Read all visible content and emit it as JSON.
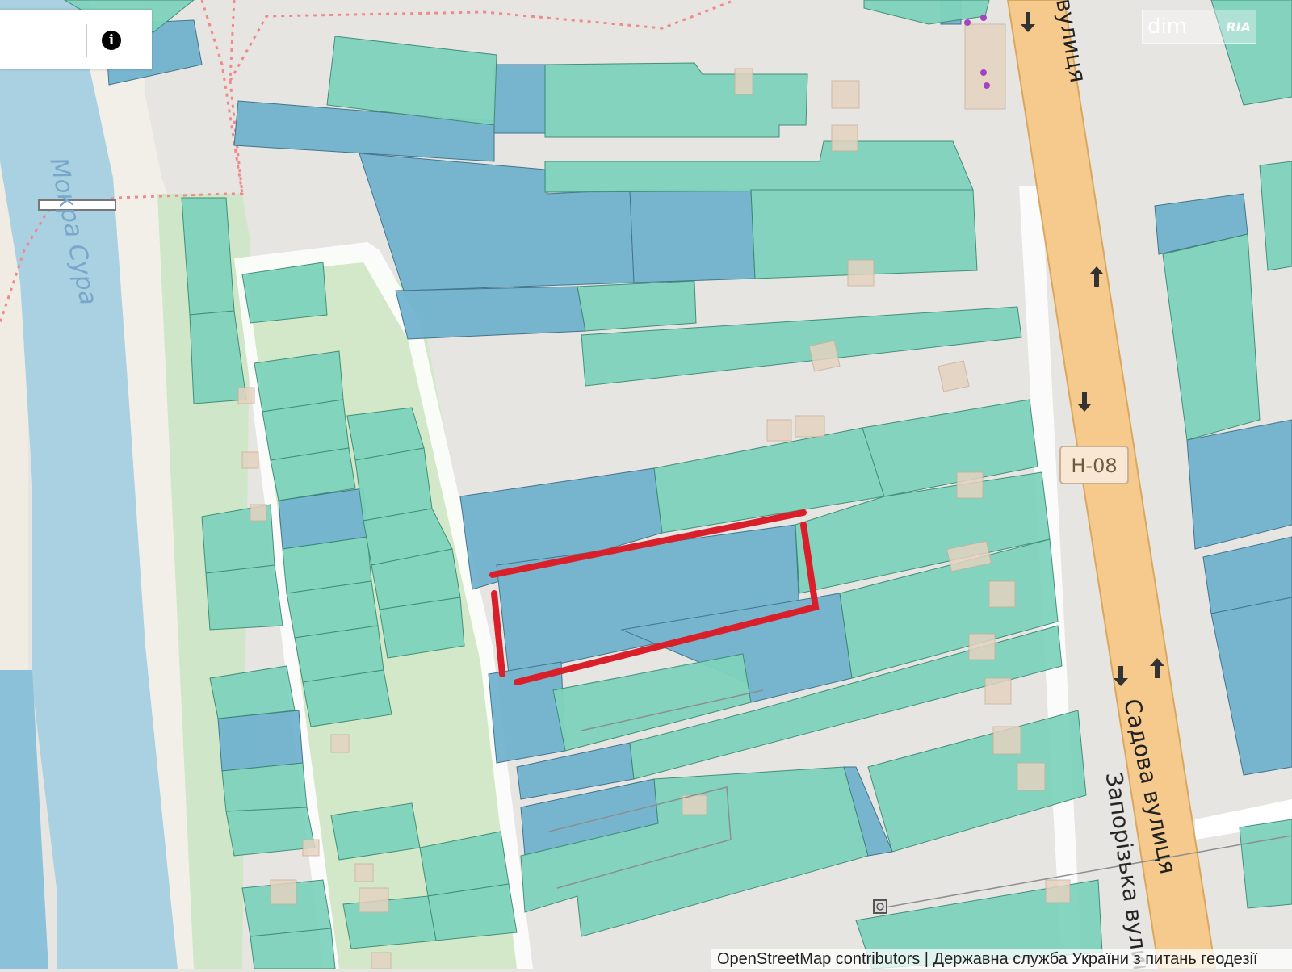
{
  "map": {
    "labels": {
      "river": "Мокра Сура",
      "street_top": "вулиця",
      "street_sadova": "Садова вулиця",
      "street_zaporizka": "Запорізька вулиця"
    },
    "road_shield": "Н-08",
    "attribution": "OpenStreetMap contributors | Державна служба України з питань геодезії",
    "watermark": {
      "text": "dim",
      "logo": "RIA"
    },
    "colors": {
      "background": "#e7e5e2",
      "green_parcel": "#7fd3bd",
      "blue_parcel": "#72b3cf",
      "highlight_outline": "#d91f2a",
      "main_road": "#f6c98c",
      "river": "#a9d1e2"
    }
  },
  "controls": {
    "info_icon": "info-icon"
  }
}
